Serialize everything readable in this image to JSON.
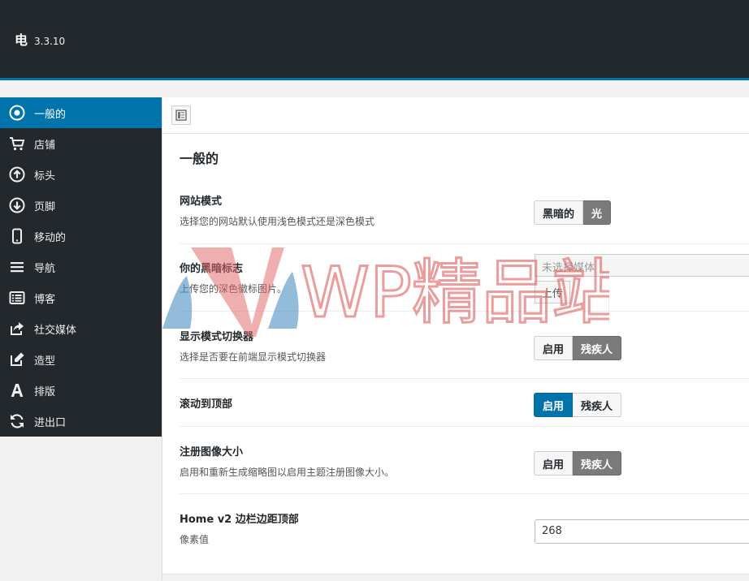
{
  "header": {
    "logo": "电",
    "version": "3.3.10"
  },
  "sidebar": {
    "items": [
      {
        "label": "一般的",
        "icon": "circle-dot-icon"
      },
      {
        "label": "店铺",
        "icon": "cart-icon"
      },
      {
        "label": "标头",
        "icon": "arrow-up-circle-icon"
      },
      {
        "label": "页脚",
        "icon": "arrow-down-circle-icon"
      },
      {
        "label": "移动的",
        "icon": "mobile-icon"
      },
      {
        "label": "导航",
        "icon": "menu-icon"
      },
      {
        "label": "博客",
        "icon": "list-icon"
      },
      {
        "label": "社交媒体",
        "icon": "share-icon"
      },
      {
        "label": "造型",
        "icon": "edit-icon"
      },
      {
        "label": "排版",
        "icon": "font-icon"
      },
      {
        "label": "进出口",
        "icon": "refresh-icon"
      }
    ]
  },
  "main": {
    "section_title": "一般的",
    "site_mode": {
      "title": "网站模式",
      "desc": "选择您的网站默认使用浅色模式还是深色模式",
      "opt_dark": "黑暗的",
      "opt_light": "光"
    },
    "dark_logo": {
      "title": "你的黑暗标志",
      "desc": "上传您的深色徽标图片。",
      "placeholder": "未选择媒体",
      "upload": "上传"
    },
    "mode_switcher": {
      "title": "显示模式切换器",
      "desc": "选择是否要在前端显示模式切换器",
      "enable": "启用",
      "disable": "残疾人"
    },
    "scroll_top": {
      "title": "滚动到顶部",
      "enable": "启用",
      "disable": "残疾人"
    },
    "image_sizes": {
      "title": "注册图像大小",
      "desc": "启用和重新生成缩略图以启用主题注册图像大小。",
      "enable": "启用",
      "disable": "残疾人"
    },
    "sidebar_top": {
      "title": "Home v2 边栏边距顶部",
      "desc": "像素值",
      "value": "268"
    }
  },
  "watermark": {
    "text": "WP精品站"
  },
  "colors": {
    "accent": "#0073aa",
    "dark": "#23282d",
    "watermark": "#e06666"
  }
}
